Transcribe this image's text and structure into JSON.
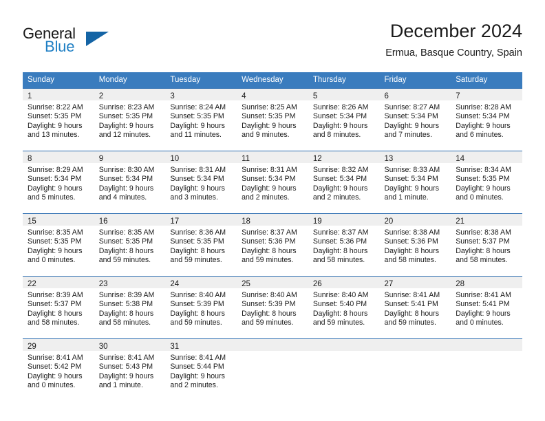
{
  "logo": {
    "word_top": "General",
    "word_bottom": "Blue",
    "triangle_color": "#1464a5",
    "blue_color": "#1f7fc4"
  },
  "header": {
    "title": "December 2024",
    "subtitle": "Ermua, Basque Country, Spain"
  },
  "theme": {
    "header_bg": "#3a7cbe",
    "row_divider": "#2a6cb0",
    "daynum_band": "#efefef"
  },
  "weekdays": [
    "Sunday",
    "Monday",
    "Tuesday",
    "Wednesday",
    "Thursday",
    "Friday",
    "Saturday"
  ],
  "weeks": [
    [
      {
        "day": "1",
        "sunrise": "Sunrise: 8:22 AM",
        "sunset": "Sunset: 5:35 PM",
        "daylight1": "Daylight: 9 hours",
        "daylight2": "and 13 minutes."
      },
      {
        "day": "2",
        "sunrise": "Sunrise: 8:23 AM",
        "sunset": "Sunset: 5:35 PM",
        "daylight1": "Daylight: 9 hours",
        "daylight2": "and 12 minutes."
      },
      {
        "day": "3",
        "sunrise": "Sunrise: 8:24 AM",
        "sunset": "Sunset: 5:35 PM",
        "daylight1": "Daylight: 9 hours",
        "daylight2": "and 11 minutes."
      },
      {
        "day": "4",
        "sunrise": "Sunrise: 8:25 AM",
        "sunset": "Sunset: 5:35 PM",
        "daylight1": "Daylight: 9 hours",
        "daylight2": "and 9 minutes."
      },
      {
        "day": "5",
        "sunrise": "Sunrise: 8:26 AM",
        "sunset": "Sunset: 5:34 PM",
        "daylight1": "Daylight: 9 hours",
        "daylight2": "and 8 minutes."
      },
      {
        "day": "6",
        "sunrise": "Sunrise: 8:27 AM",
        "sunset": "Sunset: 5:34 PM",
        "daylight1": "Daylight: 9 hours",
        "daylight2": "and 7 minutes."
      },
      {
        "day": "7",
        "sunrise": "Sunrise: 8:28 AM",
        "sunset": "Sunset: 5:34 PM",
        "daylight1": "Daylight: 9 hours",
        "daylight2": "and 6 minutes."
      }
    ],
    [
      {
        "day": "8",
        "sunrise": "Sunrise: 8:29 AM",
        "sunset": "Sunset: 5:34 PM",
        "daylight1": "Daylight: 9 hours",
        "daylight2": "and 5 minutes."
      },
      {
        "day": "9",
        "sunrise": "Sunrise: 8:30 AM",
        "sunset": "Sunset: 5:34 PM",
        "daylight1": "Daylight: 9 hours",
        "daylight2": "and 4 minutes."
      },
      {
        "day": "10",
        "sunrise": "Sunrise: 8:31 AM",
        "sunset": "Sunset: 5:34 PM",
        "daylight1": "Daylight: 9 hours",
        "daylight2": "and 3 minutes."
      },
      {
        "day": "11",
        "sunrise": "Sunrise: 8:31 AM",
        "sunset": "Sunset: 5:34 PM",
        "daylight1": "Daylight: 9 hours",
        "daylight2": "and 2 minutes."
      },
      {
        "day": "12",
        "sunrise": "Sunrise: 8:32 AM",
        "sunset": "Sunset: 5:34 PM",
        "daylight1": "Daylight: 9 hours",
        "daylight2": "and 2 minutes."
      },
      {
        "day": "13",
        "sunrise": "Sunrise: 8:33 AM",
        "sunset": "Sunset: 5:34 PM",
        "daylight1": "Daylight: 9 hours",
        "daylight2": "and 1 minute."
      },
      {
        "day": "14",
        "sunrise": "Sunrise: 8:34 AM",
        "sunset": "Sunset: 5:35 PM",
        "daylight1": "Daylight: 9 hours",
        "daylight2": "and 0 minutes."
      }
    ],
    [
      {
        "day": "15",
        "sunrise": "Sunrise: 8:35 AM",
        "sunset": "Sunset: 5:35 PM",
        "daylight1": "Daylight: 9 hours",
        "daylight2": "and 0 minutes."
      },
      {
        "day": "16",
        "sunrise": "Sunrise: 8:35 AM",
        "sunset": "Sunset: 5:35 PM",
        "daylight1": "Daylight: 8 hours",
        "daylight2": "and 59 minutes."
      },
      {
        "day": "17",
        "sunrise": "Sunrise: 8:36 AM",
        "sunset": "Sunset: 5:35 PM",
        "daylight1": "Daylight: 8 hours",
        "daylight2": "and 59 minutes."
      },
      {
        "day": "18",
        "sunrise": "Sunrise: 8:37 AM",
        "sunset": "Sunset: 5:36 PM",
        "daylight1": "Daylight: 8 hours",
        "daylight2": "and 59 minutes."
      },
      {
        "day": "19",
        "sunrise": "Sunrise: 8:37 AM",
        "sunset": "Sunset: 5:36 PM",
        "daylight1": "Daylight: 8 hours",
        "daylight2": "and 58 minutes."
      },
      {
        "day": "20",
        "sunrise": "Sunrise: 8:38 AM",
        "sunset": "Sunset: 5:36 PM",
        "daylight1": "Daylight: 8 hours",
        "daylight2": "and 58 minutes."
      },
      {
        "day": "21",
        "sunrise": "Sunrise: 8:38 AM",
        "sunset": "Sunset: 5:37 PM",
        "daylight1": "Daylight: 8 hours",
        "daylight2": "and 58 minutes."
      }
    ],
    [
      {
        "day": "22",
        "sunrise": "Sunrise: 8:39 AM",
        "sunset": "Sunset: 5:37 PM",
        "daylight1": "Daylight: 8 hours",
        "daylight2": "and 58 minutes."
      },
      {
        "day": "23",
        "sunrise": "Sunrise: 8:39 AM",
        "sunset": "Sunset: 5:38 PM",
        "daylight1": "Daylight: 8 hours",
        "daylight2": "and 58 minutes."
      },
      {
        "day": "24",
        "sunrise": "Sunrise: 8:40 AM",
        "sunset": "Sunset: 5:39 PM",
        "daylight1": "Daylight: 8 hours",
        "daylight2": "and 59 minutes."
      },
      {
        "day": "25",
        "sunrise": "Sunrise: 8:40 AM",
        "sunset": "Sunset: 5:39 PM",
        "daylight1": "Daylight: 8 hours",
        "daylight2": "and 59 minutes."
      },
      {
        "day": "26",
        "sunrise": "Sunrise: 8:40 AM",
        "sunset": "Sunset: 5:40 PM",
        "daylight1": "Daylight: 8 hours",
        "daylight2": "and 59 minutes."
      },
      {
        "day": "27",
        "sunrise": "Sunrise: 8:41 AM",
        "sunset": "Sunset: 5:41 PM",
        "daylight1": "Daylight: 8 hours",
        "daylight2": "and 59 minutes."
      },
      {
        "day": "28",
        "sunrise": "Sunrise: 8:41 AM",
        "sunset": "Sunset: 5:41 PM",
        "daylight1": "Daylight: 9 hours",
        "daylight2": "and 0 minutes."
      }
    ],
    [
      {
        "day": "29",
        "sunrise": "Sunrise: 8:41 AM",
        "sunset": "Sunset: 5:42 PM",
        "daylight1": "Daylight: 9 hours",
        "daylight2": "and 0 minutes."
      },
      {
        "day": "30",
        "sunrise": "Sunrise: 8:41 AM",
        "sunset": "Sunset: 5:43 PM",
        "daylight1": "Daylight: 9 hours",
        "daylight2": "and 1 minute."
      },
      {
        "day": "31",
        "sunrise": "Sunrise: 8:41 AM",
        "sunset": "Sunset: 5:44 PM",
        "daylight1": "Daylight: 9 hours",
        "daylight2": "and 2 minutes."
      },
      {
        "day": "",
        "sunrise": "",
        "sunset": "",
        "daylight1": "",
        "daylight2": ""
      },
      {
        "day": "",
        "sunrise": "",
        "sunset": "",
        "daylight1": "",
        "daylight2": ""
      },
      {
        "day": "",
        "sunrise": "",
        "sunset": "",
        "daylight1": "",
        "daylight2": ""
      },
      {
        "day": "",
        "sunrise": "",
        "sunset": "",
        "daylight1": "",
        "daylight2": ""
      }
    ]
  ]
}
